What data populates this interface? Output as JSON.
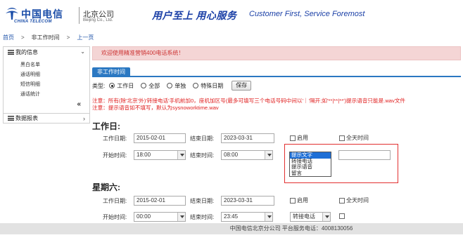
{
  "header": {
    "logo_cn": "中国电信",
    "logo_en": "CHINA TELECOM",
    "branch_cn": "北京公司",
    "branch_en": "Beijing Co., Ltd.",
    "slogan_cn": "用户至上 用心服务",
    "slogan_en": "Customer First, Service Foremost"
  },
  "breadcrumb": {
    "home": "首页",
    "separator": ">",
    "current": "非工作时间",
    "back": "上一页"
  },
  "sidebar": {
    "my_info": "我的信息",
    "items": [
      "黑白名单",
      "通话明细",
      "短信明细",
      "通话统计"
    ],
    "collapse_icon": "«",
    "reports": "数据报表"
  },
  "welcome": "欢迎使用精准营销400电话系统！",
  "tab": "非工作时间",
  "type_row": {
    "label": "类型:",
    "options": [
      "工作日",
      "全部",
      "单独",
      "特殊日期"
    ],
    "selected": 0,
    "save": "保存"
  },
  "notice": {
    "line1": "注意：所有(除'北京'外)'转接电话'手机前加0，座机加区号(最多可填写三个电话号码中间以'｜'隔开;如'**|**|**')提示语音只能是.wav文件",
    "line2": "注意：提示语音如不填写，默认为sysnoworktime.wav"
  },
  "workday": {
    "title": "工作日:",
    "work_date_label": "工作日期:",
    "work_date_value": "2015-02-01",
    "end_date_label": "结束日期:",
    "end_date_value": "2023-03-31",
    "enable_label": "启用",
    "all_day_label": "全天时间",
    "start_time_label": "开始时间:",
    "start_time_value": "18:00",
    "end_time_label": "结束时间:",
    "end_time_value": "08:00",
    "dropdown_options": [
      "提示文字",
      "转接电话",
      "提示语音",
      "留言"
    ],
    "dropdown_selected": 0
  },
  "saturday": {
    "title": "星期六:",
    "work_date_label": "工作日期:",
    "work_date_value": "2015-02-01",
    "end_date_label": "结束日期:",
    "end_date_value": "2023-03-31",
    "enable_label": "启用",
    "all_day_label": "全天时间",
    "start_time_label": "开始时间:",
    "start_time_value": "00:00",
    "end_time_label": "结束时间:",
    "end_time_value": "23:45",
    "mode_value": "转接电话"
  },
  "footer": "中国电信北京分公司 平台服务电话：4008130056",
  "colors": {
    "brand_blue": "#1a4da8",
    "tab_blue": "#2b78c2",
    "alert_red": "#e02020",
    "welcome_bg": "#f4d5d5"
  }
}
